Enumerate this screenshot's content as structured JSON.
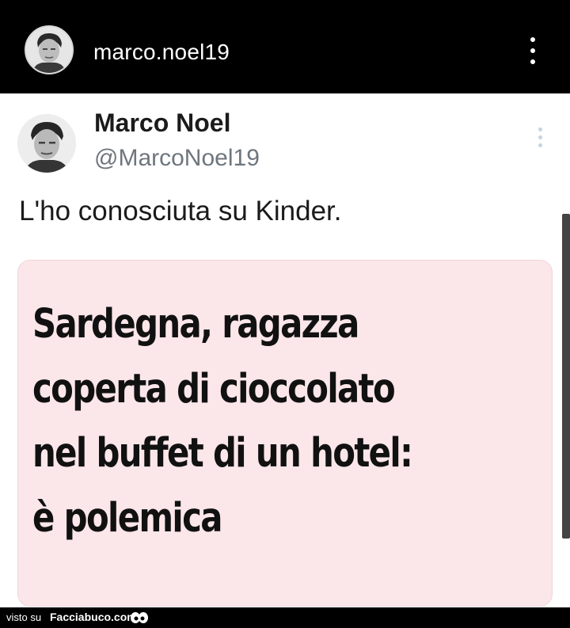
{
  "header": {
    "username": "marco.noel19",
    "avatar_icon": "profile-photo-icon",
    "more_icon": "vertical-dots-icon"
  },
  "tweet": {
    "display_name": "Marco Noel",
    "handle": "@MarcoNoel19",
    "text": "L'ho conosciuta su Kinder.",
    "more_icon": "vertical-dots-icon"
  },
  "news_card": {
    "headline_lines": [
      "Sardegna, ragazza",
      "coperta di cioccolato",
      "nel buffet di un hotel:",
      "è polemica"
    ],
    "background": "#fbe6e9"
  },
  "footer": {
    "prefix": "visto su",
    "site": "Facciabuco.com",
    "logo_icon": "eyes-logo-icon"
  }
}
